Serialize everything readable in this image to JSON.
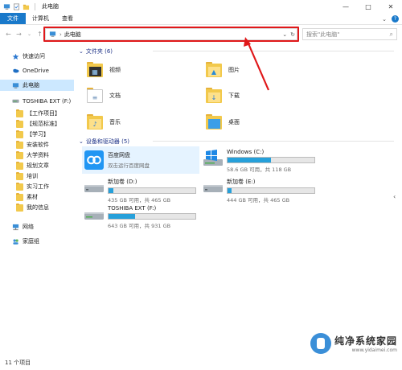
{
  "titlebar": {
    "title": "此电脑"
  },
  "ribbon": {
    "tabs": [
      "文件",
      "计算机",
      "查看"
    ]
  },
  "address": {
    "crumb": "此电脑",
    "search_placeholder": "搜索\"此电脑\""
  },
  "sidebar": {
    "quick_access": "快速访问",
    "onedrive": "OneDrive",
    "this_pc": "此电脑",
    "toshiba": "TOSHIBA EXT (F:)",
    "folders": [
      "【工作项目】",
      "【规范标准】",
      "【学习】",
      "安装软件",
      "大学资料",
      "规划文章",
      "培训",
      "实习工作",
      "素材",
      "我的信息"
    ],
    "network": "网络",
    "homegroup": "家庭组"
  },
  "main": {
    "folders_header": "文件夹 (6)",
    "folders": [
      {
        "label": "视频",
        "icon": "video-folder-icon"
      },
      {
        "label": "图片",
        "icon": "pictures-folder-icon"
      },
      {
        "label": "文档",
        "icon": "documents-folder-icon"
      },
      {
        "label": "下载",
        "icon": "downloads-folder-icon"
      },
      {
        "label": "音乐",
        "icon": "music-folder-icon"
      },
      {
        "label": "桌面",
        "icon": "desktop-folder-icon"
      }
    ],
    "devices_header": "设备和驱动器 (5)",
    "baidu": {
      "name": "百度网盘",
      "desc": "双击运行百度网盘"
    },
    "drives": [
      {
        "name": "Windows (C:)",
        "cap": "58.6 GB 可用，共 118 GB",
        "used": 0.5
      },
      {
        "name": "新加卷 (D:)",
        "cap": "435 GB 可用，共 465 GB",
        "used": 0.06
      },
      {
        "name": "新加卷 (E:)",
        "cap": "444 GB 可用，共 465 GB",
        "used": 0.05
      },
      {
        "name": "TOSHIBA EXT (F:)",
        "cap": "643 GB 可用，共 931 GB",
        "used": 0.31
      }
    ]
  },
  "status": {
    "count": "11 个项目"
  },
  "watermark": {
    "brand": "纯净系统家园",
    "url": "www.yidaimei.com"
  },
  "colors": {
    "accent": "#1979ca",
    "annotation": "#e0181a",
    "drive_fill": "#26a0da",
    "folder": "#f2c94c"
  }
}
